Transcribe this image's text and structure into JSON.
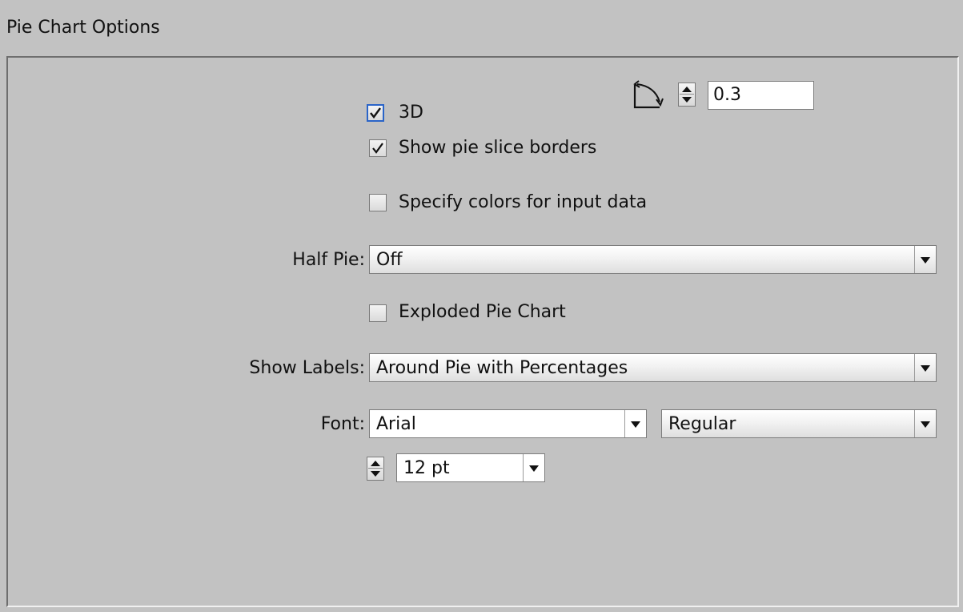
{
  "dialog": {
    "title": "Pie Chart Options"
  },
  "options": {
    "three_d": {
      "label": "3D",
      "checked": true
    },
    "angle": {
      "icon": "rotation-angle-icon",
      "value": "0.3"
    },
    "show_borders": {
      "label": "Show pie slice borders",
      "checked": true
    },
    "specify_colors": {
      "label": "Specify colors for input data",
      "checked": false
    },
    "half_pie": {
      "label": "Half Pie:",
      "value": "Off"
    },
    "exploded": {
      "label": "Exploded Pie Chart",
      "checked": false
    },
    "show_labels": {
      "label": "Show Labels:",
      "value": "Around Pie with Percentages"
    },
    "font": {
      "label": "Font:",
      "family": "Arial",
      "style": "Regular",
      "size": "12 pt"
    }
  },
  "colors": {
    "focus_border": "#2a64c8",
    "panel_bg": "#c2c2c2"
  }
}
